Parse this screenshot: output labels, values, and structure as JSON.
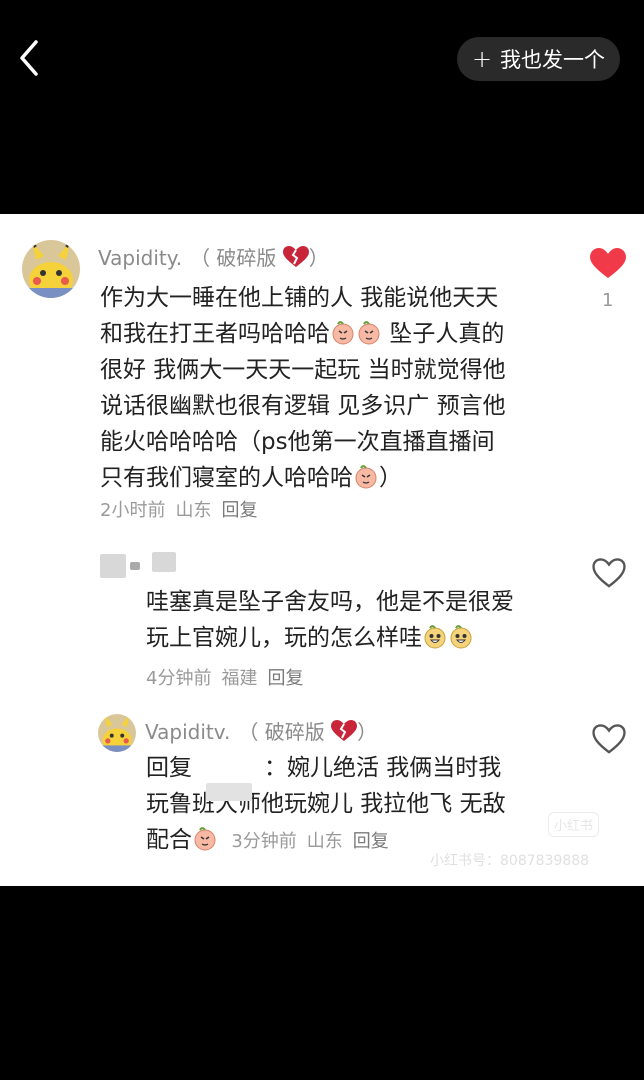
{
  "header": {
    "post_button_label": "我也发一个"
  },
  "comments": [
    {
      "author": "Vapidity.",
      "tag": "（ 破碎版",
      "tag_close": "）",
      "lines": [
        "作为大一睡在他上铺的人 我能说他天天",
        "和我在打王者吗哈哈哈",
        "很好 我俩大一天天一起玩 当时就觉得他",
        "说话很幽默也很有逻辑 见多识广 预言他",
        "能火哈哈哈哈（ps他第一次直播直播间",
        "只有我们寝室的人哈哈哈"
      ],
      "line2_tail": "坠子人真的",
      "line6_tail": "）",
      "time": "2小时前",
      "location": "山东",
      "reply_label": "回复",
      "like_count": "1",
      "liked": true
    },
    {
      "author": "",
      "lines": [
        "哇塞真是坠子舍友吗，他是不是很爱",
        "玩上官婉儿，玩的怎么样哇"
      ],
      "time": "4分钟前",
      "location": "福建",
      "reply_label": "回复"
    },
    {
      "author": "Vapiditv.",
      "tag": "（ 破碎版",
      "tag_close": "）",
      "reply_prefix": "回复",
      "line1_tail": "：婉儿绝活 我俩当时我",
      "line2": "玩鲁班大师他玩婉儿 我拉他飞 无敌",
      "line3": "配合",
      "time": "3分钟前",
      "location": "山东",
      "reply_label": "回复"
    }
  ],
  "watermark": {
    "logo": "小红书",
    "id_text": "小红书号：8087839888"
  },
  "colors": {
    "like_red": "#f03a4a",
    "background": "#000000",
    "card": "#ffffff"
  }
}
